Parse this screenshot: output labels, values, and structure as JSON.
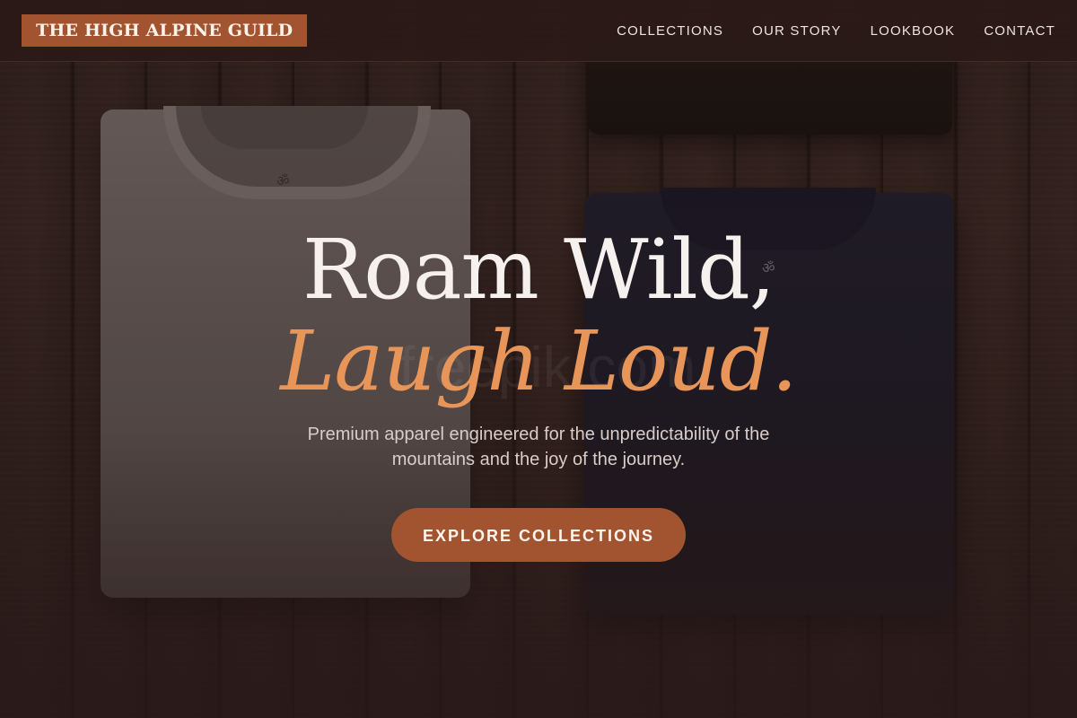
{
  "header": {
    "brand": "THE HIGH ALPINE GUILD",
    "nav": [
      "COLLECTIONS",
      "OUR STORY",
      "LOOKBOOK",
      "CONTACT"
    ]
  },
  "hero": {
    "headline_line1": "Roam Wild,",
    "headline_line2": "Laugh Loud.",
    "subtext": "Premium apparel engineered for the unpredictability of the mountains and the joy of the journey.",
    "cta": "EXPLORE COLLECTIONS",
    "watermark": "freepik.com"
  },
  "colors": {
    "accent": "#a2532f",
    "headline_accent": "#e8955a",
    "background": "#2b1c19"
  }
}
